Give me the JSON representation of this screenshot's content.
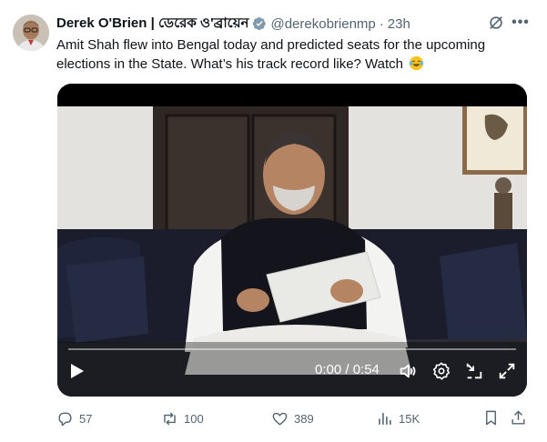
{
  "tweet": {
    "author_name": "Derek O'Brien | ডেরেক ও'ব্রায়েন",
    "handle": "@derekobrienmp",
    "separator": "·",
    "time": "23h",
    "text": "Amit Shah flew into Bengal today and predicted seats for the upcoming elections in the State. What’s his track record like? Watch",
    "emoji": "tears-of-joy-emoji"
  },
  "video": {
    "timecode": "0:00 / 0:54",
    "progress": 0.0,
    "icons": [
      "play-icon",
      "volume-icon",
      "settings-icon",
      "fullscreen-exit-icon",
      "expand-icon"
    ]
  },
  "actions": {
    "replies": "57",
    "reposts": "100",
    "likes": "389",
    "views": "15K"
  },
  "colors": {
    "text": "#0f1419",
    "secondary": "#536471",
    "verified": "#829aab"
  }
}
